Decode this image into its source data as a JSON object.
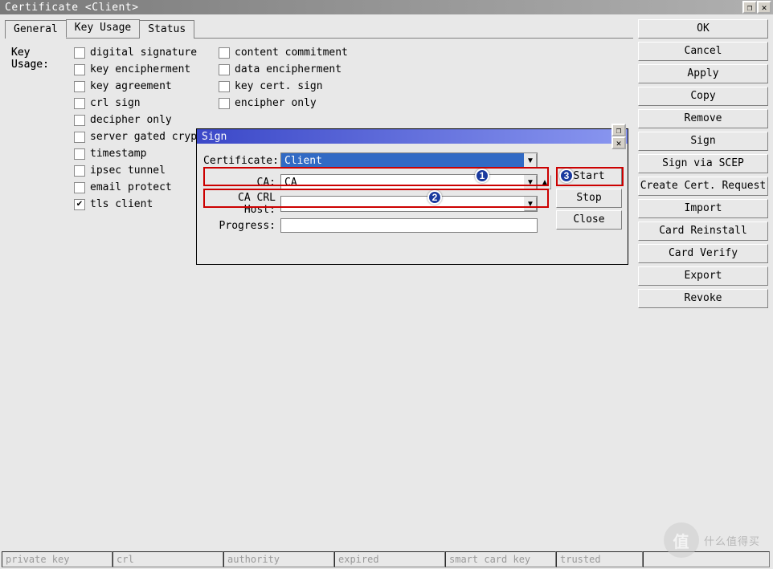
{
  "window": {
    "title": "Certificate <Client>"
  },
  "tabs": {
    "general": "General",
    "key_usage": "Key Usage",
    "status": "Status"
  },
  "key_usage": {
    "label": "Key Usage:",
    "items_col1": [
      {
        "label": "digital signature",
        "checked": false
      },
      {
        "label": "key encipherment",
        "checked": false
      },
      {
        "label": "key agreement",
        "checked": false
      },
      {
        "label": "crl sign",
        "checked": false
      },
      {
        "label": "decipher only",
        "checked": false
      },
      {
        "label": "server gated crypto",
        "checked": false
      },
      {
        "label": "timestamp",
        "checked": false
      },
      {
        "label": "ipsec tunnel",
        "checked": false
      },
      {
        "label": "email protect",
        "checked": false
      },
      {
        "label": "tls client",
        "checked": true
      }
    ],
    "items_col2": [
      {
        "label": "content commitment",
        "checked": false
      },
      {
        "label": "data encipherment",
        "checked": false
      },
      {
        "label": "key cert. sign",
        "checked": false
      },
      {
        "label": "encipher only",
        "checked": false
      }
    ]
  },
  "buttons": {
    "ok": "OK",
    "cancel": "Cancel",
    "apply": "Apply",
    "copy": "Copy",
    "remove": "Remove",
    "sign": "Sign",
    "sign_scep": "Sign via SCEP",
    "create_req": "Create Cert. Request",
    "import": "Import",
    "card_reinstall": "Card Reinstall",
    "card_verify": "Card Verify",
    "export": "Export",
    "revoke": "Revoke"
  },
  "sign_dialog": {
    "title": "Sign",
    "certificate_label": "Certificate:",
    "certificate_value": "Client",
    "ca_label": "CA:",
    "ca_value": "CA",
    "ca_crl_label": "CA CRL Host:",
    "ca_crl_value": "",
    "progress_label": "Progress:",
    "start": "Start",
    "stop": "Stop",
    "close": "Close",
    "annot": {
      "n1": "1",
      "n2": "2",
      "n3": "3"
    }
  },
  "status_bar": {
    "cells": [
      "private key",
      "crl",
      "authority",
      "expired",
      "smart card key",
      "trusted",
      ""
    ]
  },
  "watermark": {
    "logo": "值",
    "text": "什么值得买"
  }
}
